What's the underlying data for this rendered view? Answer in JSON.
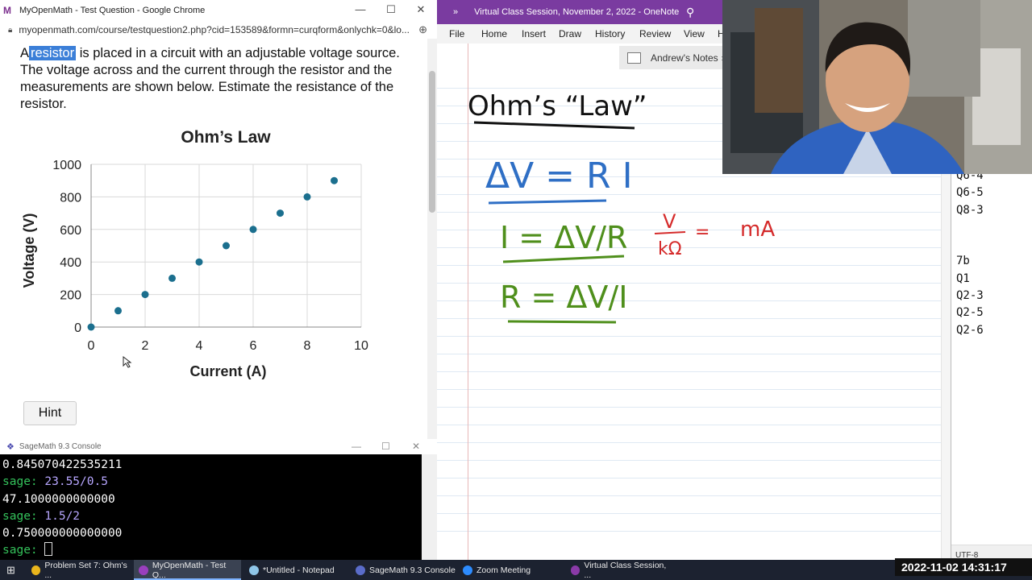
{
  "chrome": {
    "title": "MyOpenMath - Test Question - Google Chrome",
    "url": "myopenmath.com/course/testquestion2.php?cid=153589&formn=curqform&onlychk=0&lo..."
  },
  "question": {
    "pre": "A",
    "highlight": "resistor",
    "rest": "is placed in a circuit with an adjustable voltage source. The voltage across and the current through the resistor and the measurements are shown below. Estimate the resistance of the resistor."
  },
  "hint_label": "Hint",
  "chart_data": {
    "type": "scatter",
    "title": "Ohm’s Law",
    "xlabel": "Current (A)",
    "ylabel": "Voltage (V)",
    "xlim": [
      0,
      10
    ],
    "ylim": [
      0,
      1000
    ],
    "xticks": [
      0,
      2,
      4,
      6,
      8,
      10
    ],
    "yticks": [
      0,
      200,
      400,
      600,
      800,
      1000
    ],
    "grid": true,
    "point_color": "#1b6f8e",
    "points": [
      {
        "x": 0,
        "y": 0
      },
      {
        "x": 1,
        "y": 100
      },
      {
        "x": 2,
        "y": 200
      },
      {
        "x": 3,
        "y": 300
      },
      {
        "x": 4,
        "y": 400
      },
      {
        "x": 5,
        "y": 500
      },
      {
        "x": 6,
        "y": 600
      },
      {
        "x": 7,
        "y": 700
      },
      {
        "x": 8,
        "y": 800
      },
      {
        "x": 9,
        "y": 900
      }
    ]
  },
  "sage": {
    "title": "SageMath 9.3 Console",
    "lines": [
      {
        "kind": "out",
        "text": "0.845070422535211"
      },
      {
        "kind": "in",
        "prompt": "sage:",
        "text": "23.55/0.5"
      },
      {
        "kind": "out",
        "text": "47.1000000000000"
      },
      {
        "kind": "in",
        "prompt": "sage:",
        "text": "1.5/2"
      },
      {
        "kind": "out",
        "text": "0.750000000000000"
      },
      {
        "kind": "prompt",
        "prompt": "sage:",
        "text": ""
      }
    ]
  },
  "onenote": {
    "title": "Virtual Class Session, November 2, 2022  -  OneNote",
    "menu": [
      "File",
      "Home",
      "Insert",
      "Draw",
      "History",
      "Review",
      "View",
      "H"
    ],
    "notebook": "Andrew's Notes",
    "ink": {
      "heading": "Ohm’s “Law”",
      "eq1": "ΔV = R I",
      "eq2": "I = ΔV/R",
      "eq3": "R = ΔV/I",
      "units_num": "V",
      "units_den": "kΩ",
      "units_eq": "=",
      "units_res": "mA"
    }
  },
  "notepad": {
    "lines": [
      "Q6-4",
      "Q6-5",
      "Q8-3",
      "",
      "",
      "7b",
      "Q1",
      "Q2-3",
      "Q2-5",
      "Q2-6"
    ],
    "encoding": "UTF-8"
  },
  "taskbar": {
    "items": [
      {
        "label": "Problem Set 7: Ohm's ...",
        "icon": "chrome-icon",
        "color": "#e9b51c"
      },
      {
        "label": "MyOpenMath - Test Q...",
        "icon": "myopenmath-icon",
        "color": "#9a3fbd"
      },
      {
        "label": "*Untitled - Notepad",
        "icon": "notepad-icon",
        "color": "#8fc6e8"
      },
      {
        "label": "SageMath 9.3 Console",
        "icon": "sagemath-icon",
        "color": "#5a6cc9"
      },
      {
        "label": "Zoom Meeting",
        "icon": "zoom-icon",
        "color": "#2d8cff"
      },
      {
        "label": "Virtual Class Session, ...",
        "icon": "onenote-icon",
        "color": "#8b3aa8"
      }
    ],
    "clock": "2022-11-02  14:31:17"
  }
}
